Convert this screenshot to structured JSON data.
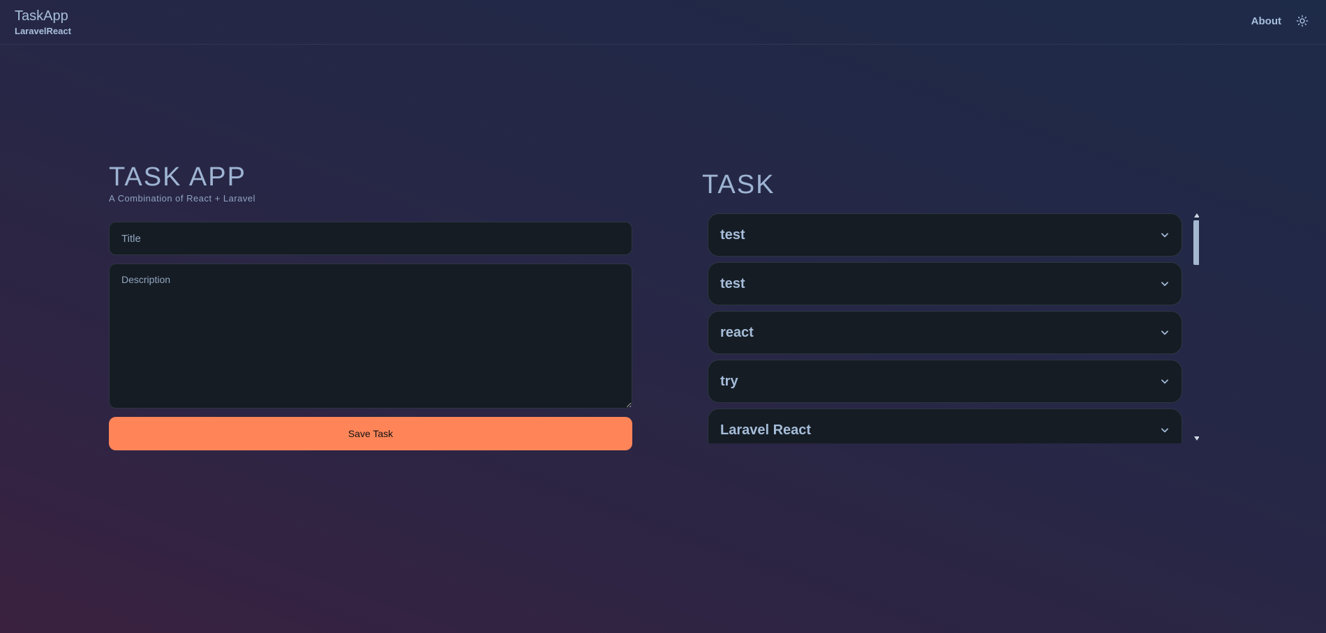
{
  "navbar": {
    "brand_title": "TaskApp",
    "brand_subtitle": "LaravelReact",
    "about_label": "About",
    "theme_icon": "sun-icon"
  },
  "form": {
    "title": "TASK APP",
    "subtitle": "A Combination of React + Laravel",
    "title_placeholder": "Title",
    "description_placeholder": "Description",
    "save_label": "Save Task"
  },
  "tasks": {
    "heading": "TASK",
    "items": [
      {
        "label": "test"
      },
      {
        "label": "test"
      },
      {
        "label": "react"
      },
      {
        "label": "try"
      },
      {
        "label": "Laravel React"
      }
    ]
  },
  "colors": {
    "accent": "#ff8559",
    "card_bg": "#151c24",
    "text": "#a6bdd9"
  }
}
